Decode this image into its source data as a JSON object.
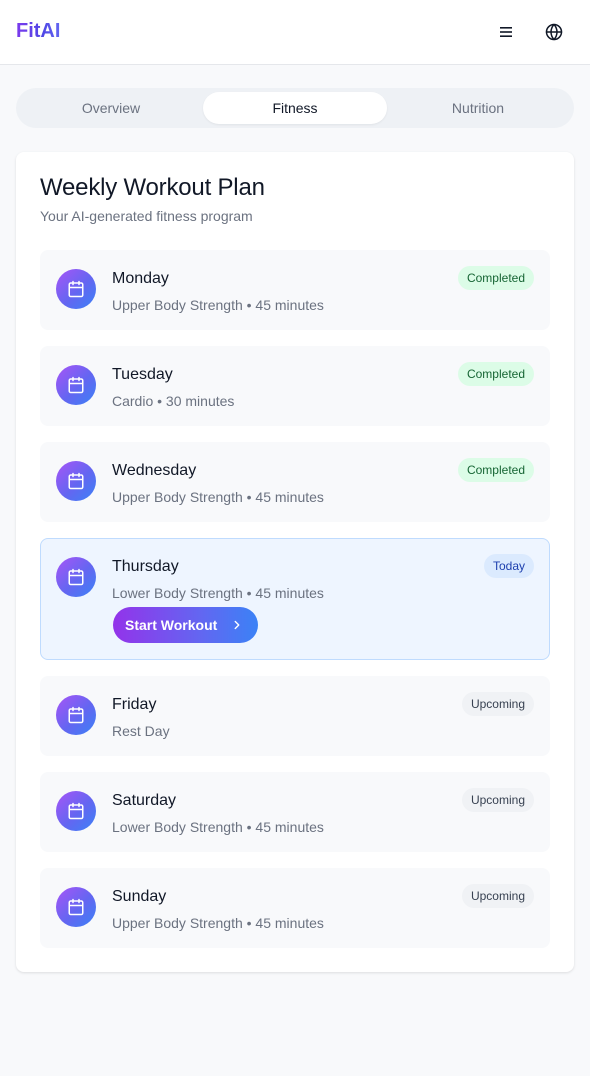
{
  "app": {
    "title": "FitAI"
  },
  "header": {
    "menu_icon": "menu-icon",
    "globe_icon": "globe-icon"
  },
  "tabs": [
    {
      "label": "Overview",
      "active": false
    },
    {
      "label": "Fitness",
      "active": true
    },
    {
      "label": "Nutrition",
      "active": false
    }
  ],
  "plan": {
    "title": "Weekly Workout Plan",
    "subtitle": "Your AI-generated fitness program",
    "days": [
      {
        "name": "Monday",
        "detail": "Upper Body Strength • 45 minutes",
        "status": "Completed"
      },
      {
        "name": "Tuesday",
        "detail": "Cardio • 30 minutes",
        "status": "Completed"
      },
      {
        "name": "Wednesday",
        "detail": "Upper Body Strength • 45 minutes",
        "status": "Completed"
      },
      {
        "name": "Thursday",
        "detail": "Lower Body Strength • 45 minutes",
        "status": "Today",
        "action": "Start Workout"
      },
      {
        "name": "Friday",
        "detail": "Rest Day",
        "status": "Upcoming"
      },
      {
        "name": "Saturday",
        "detail": "Lower Body Strength • 45 minutes",
        "status": "Upcoming"
      },
      {
        "name": "Sunday",
        "detail": "Upper Body Strength • 45 minutes",
        "status": "Upcoming"
      }
    ]
  },
  "colors": {
    "brand_start": "#7c3aed",
    "brand_end": "#4f46e5",
    "completed_bg": "#dcfce7",
    "today_bg": "#dbeafe",
    "upcoming_bg": "#f0f2f5"
  }
}
